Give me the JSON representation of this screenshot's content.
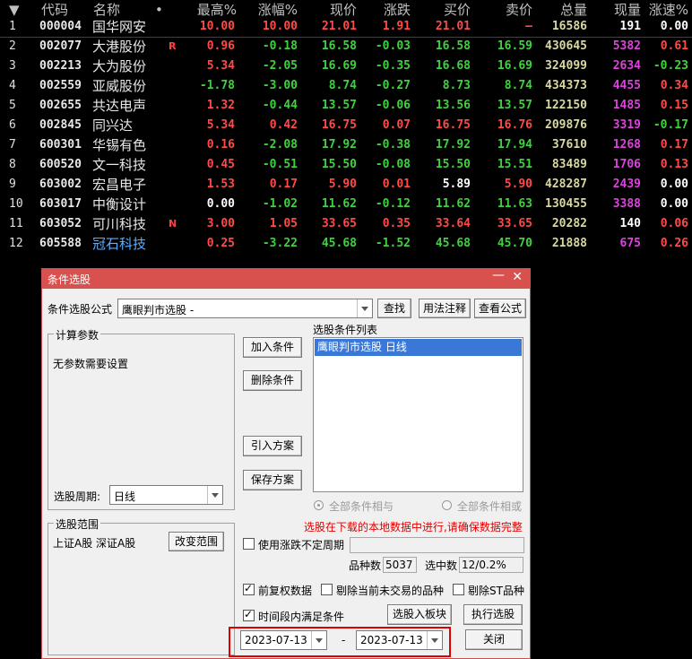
{
  "quote_table": {
    "headers": {
      "sort_arrow": "▼",
      "code": "代码",
      "name": "名称",
      "dot": "•",
      "high": "最高%",
      "pct": "涨幅%",
      "price": "现价",
      "change": "涨跌",
      "buy": "买价",
      "sell": "卖价",
      "volume": "总量",
      "current": "现量",
      "speed": "涨速%"
    },
    "rows": [
      {
        "idx": "1",
        "code": "000004",
        "name": "国华网安",
        "flag": "",
        "high": "10.00",
        "pct": "10.00",
        "price": "21.01",
        "chg": "1.91",
        "buy": "21.01",
        "sell": "–",
        "vol": "16586",
        "cur": "191",
        "speed": "0.00"
      },
      {
        "idx": "2",
        "code": "002077",
        "name": "大港股份",
        "flag": "R",
        "high": "0.96",
        "pct": "-0.18",
        "price": "16.58",
        "chg": "-0.03",
        "buy": "16.58",
        "sell": "16.59",
        "vol": "430645",
        "cur": "5382",
        "speed": "0.61"
      },
      {
        "idx": "3",
        "code": "002213",
        "name": "大为股份",
        "flag": "",
        "high": "5.34",
        "pct": "-2.05",
        "price": "16.69",
        "chg": "-0.35",
        "buy": "16.68",
        "sell": "16.69",
        "vol": "324099",
        "cur": "2634",
        "speed": "-0.23"
      },
      {
        "idx": "4",
        "code": "002559",
        "name": "亚威股份",
        "flag": "",
        "high": "-1.78",
        "pct": "-3.00",
        "price": "8.74",
        "chg": "-0.27",
        "buy": "8.73",
        "sell": "8.74",
        "vol": "434373",
        "cur": "4455",
        "speed": "0.34"
      },
      {
        "idx": "5",
        "code": "002655",
        "name": "共达电声",
        "flag": "",
        "high": "1.32",
        "pct": "-0.44",
        "price": "13.57",
        "chg": "-0.06",
        "buy": "13.56",
        "sell": "13.57",
        "vol": "122150",
        "cur": "1485",
        "speed": "0.15"
      },
      {
        "idx": "6",
        "code": "002845",
        "name": "同兴达",
        "flag": "",
        "high": "5.34",
        "pct": "0.42",
        "price": "16.75",
        "chg": "0.07",
        "buy": "16.75",
        "sell": "16.76",
        "vol": "209876",
        "cur": "3319",
        "speed": "-0.17"
      },
      {
        "idx": "7",
        "code": "600301",
        "name": "华锡有色",
        "flag": "",
        "high": "0.16",
        "pct": "-2.08",
        "price": "17.92",
        "chg": "-0.38",
        "buy": "17.92",
        "sell": "17.94",
        "vol": "37610",
        "cur": "1268",
        "speed": "0.17"
      },
      {
        "idx": "8",
        "code": "600520",
        "name": "文一科技",
        "flag": "",
        "high": "0.45",
        "pct": "-0.51",
        "price": "15.50",
        "chg": "-0.08",
        "buy": "15.50",
        "sell": "15.51",
        "vol": "83489",
        "cur": "1706",
        "speed": "0.13"
      },
      {
        "idx": "9",
        "code": "603002",
        "name": "宏昌电子",
        "flag": "",
        "high": "1.53",
        "pct": "0.17",
        "price": "5.90",
        "chg": "0.01",
        "buy": "5.89",
        "sell": "5.90",
        "vol": "428287",
        "cur": "2439",
        "speed": "0.00"
      },
      {
        "idx": "10",
        "code": "603017",
        "name": "中衡设计",
        "flag": "",
        "high": "0.00",
        "pct": "-1.02",
        "price": "11.62",
        "chg": "-0.12",
        "buy": "11.62",
        "sell": "11.63",
        "vol": "130455",
        "cur": "3388",
        "speed": "0.00"
      },
      {
        "idx": "11",
        "code": "603052",
        "name": "可川科技",
        "flag": "N",
        "high": "3.00",
        "pct": "1.05",
        "price": "33.65",
        "chg": "0.35",
        "buy": "33.64",
        "sell": "33.65",
        "vol": "20282",
        "cur": "140",
        "speed": "0.06"
      },
      {
        "idx": "12",
        "code": "605588",
        "name": "冠石科技",
        "flag": "",
        "high": "0.25",
        "pct": "-3.22",
        "price": "45.68",
        "chg": "-1.52",
        "buy": "45.68",
        "sell": "45.70",
        "vol": "21888",
        "cur": "675",
        "speed": "0.26"
      }
    ]
  },
  "dialog": {
    "title": "条件选股",
    "minimize": "—",
    "close": "✕",
    "formula_label": "条件选股公式",
    "formula_value": "鹰眼判市选股 -",
    "find_button": "查找",
    "usage_button": "用法注释",
    "view_formula_button": "查看公式",
    "params_group": "计算参数",
    "params_text": "无参数需要设置",
    "period_label": "选股周期:",
    "period_value": "日线",
    "add_condition": "加入条件",
    "delete_condition": "删除条件",
    "import_plan": "引入方案",
    "save_plan": "保存方案",
    "condition_list_label": "选股条件列表",
    "condition_items": [
      "鹰眼判市选股  日线"
    ],
    "radio_and": "全部条件相与",
    "radio_or": "全部条件相或",
    "warning": "选股在下载的本地数据中进行,请确保数据完整",
    "scope_group": "选股范围",
    "scope_text": "上证A股 深证A股",
    "change_scope": "改变范围",
    "use_uncertain_period": "使用涨跌不定周期",
    "count_label": "品种数",
    "count_value": "5037",
    "selected_label": "选中数",
    "selected_value": "12/0.2%",
    "adjusted_data": "前复权数据",
    "exclude_untraded": "剔除当前未交易的品种",
    "exclude_st": "剔除ST品种",
    "within_period": "时间段内满足条件",
    "add_to_block": "选股入板块",
    "execute": "执行选股",
    "date_from": "2023-07-13",
    "date_sep": "-",
    "date_to": "2023-07-13",
    "close_button": "关闭"
  },
  "colors": {
    "background": "#000000",
    "up": "#ff4a4a",
    "down": "#3fd23f",
    "dialog_title": "#d9514f",
    "highlight_box": "#e00000",
    "list_selection": "#3a78d8"
  }
}
